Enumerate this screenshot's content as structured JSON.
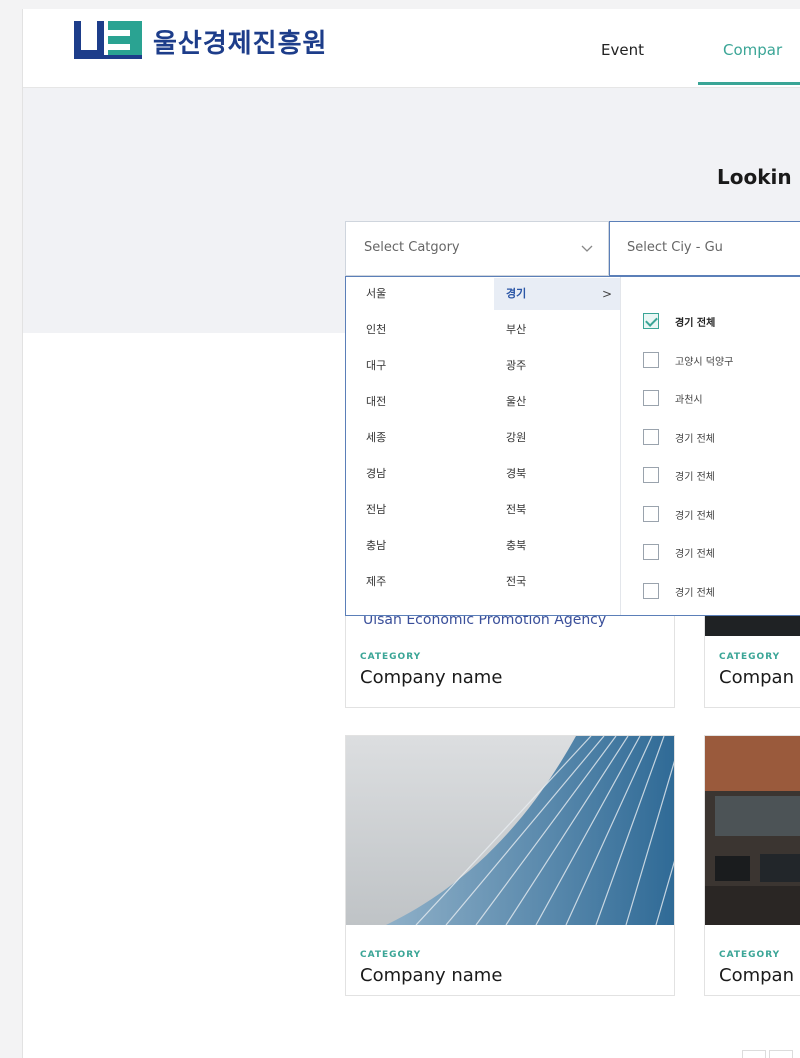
{
  "header": {
    "logo_text": "울산경제진흥원",
    "nav": [
      "Event",
      "Compar"
    ]
  },
  "main": {
    "heading": "Lookin",
    "select_category": {
      "placeholder": "Select Catgory"
    },
    "select_city": {
      "placeholder": "Select Ciy - Gu"
    }
  },
  "regions": [
    [
      "서울",
      "경기"
    ],
    [
      "인천",
      "부산"
    ],
    [
      "대구",
      "광주"
    ],
    [
      "대전",
      "울산"
    ],
    [
      "세종",
      "강원"
    ],
    [
      "경남",
      "경북"
    ],
    [
      "전남",
      "전북"
    ],
    [
      "충남",
      "충북"
    ],
    [
      "제주",
      "전국"
    ]
  ],
  "selected_region_arrow": ">",
  "city_options": [
    {
      "label": "경기 전체",
      "checked": true
    },
    {
      "label": "고양시 덕양구",
      "checked": false
    },
    {
      "label": "과천시",
      "checked": false
    },
    {
      "label": "경기 전체",
      "checked": false
    },
    {
      "label": "경기 전체",
      "checked": false
    },
    {
      "label": "경기 전체",
      "checked": false
    },
    {
      "label": "경기 전체",
      "checked": false
    },
    {
      "label": "경기 전체",
      "checked": false
    }
  ],
  "peek_text": "Ulsan Economic Promotion Agency",
  "cards": [
    {
      "category": "CATEGORY",
      "name": "Company name"
    },
    {
      "category": "CATEGORY",
      "name": "Compan"
    },
    {
      "category": "CATEGORY",
      "name": "Company name"
    },
    {
      "category": "CATEGORY",
      "name": "Compan"
    }
  ],
  "colors": {
    "accent": "#3aa596",
    "brand": "#1d3d8a",
    "border_active": "#5b7fb8"
  }
}
